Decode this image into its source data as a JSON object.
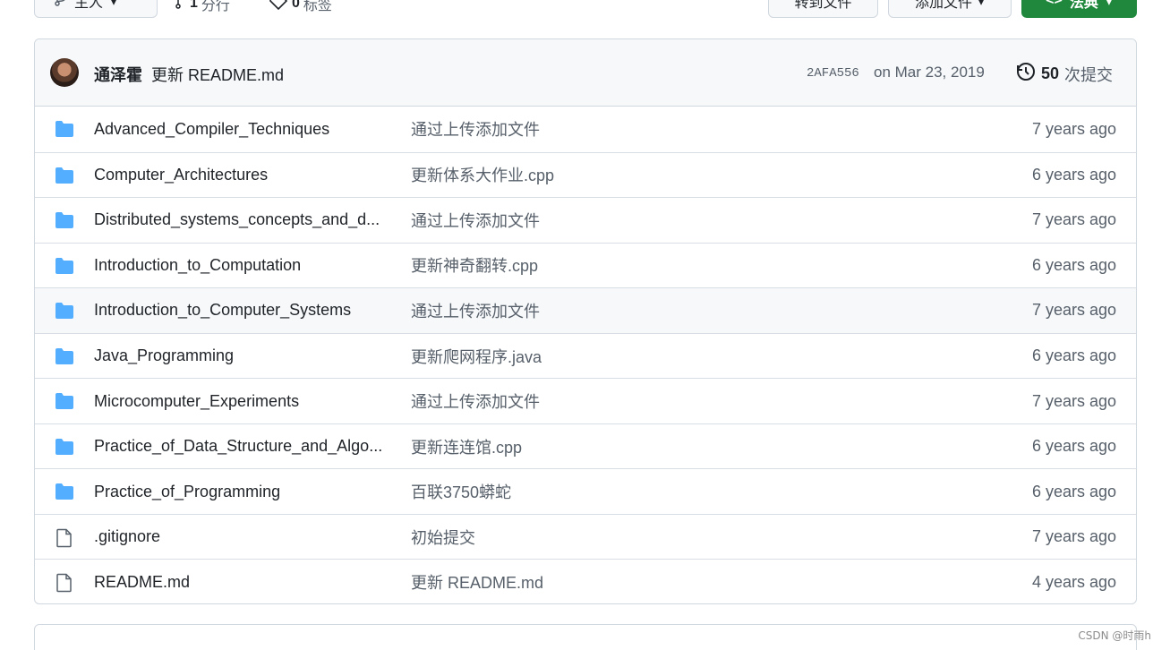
{
  "toolbar": {
    "branch_label": "主人",
    "branches_count": "1",
    "branches_label": "分行",
    "tags_count": "0",
    "tags_label": "标签",
    "goto_file_label": "转到文件",
    "add_file_label": "添加文件",
    "code_label": "法典"
  },
  "commit": {
    "author": "通泽霍",
    "message": "更新 README.md",
    "sha": "2AFA556",
    "date": "on Mar 23, 2019",
    "count": "50",
    "count_label": "次提交"
  },
  "files": [
    {
      "name": "Advanced_Compiler_Techniques",
      "type": "folder",
      "message": "通过上传添加文件",
      "age": "7 years ago"
    },
    {
      "name": "Computer_Architectures",
      "type": "folder",
      "message": "更新体系大作业.cpp",
      "age": "6 years ago"
    },
    {
      "name": "Distributed_systems_concepts_and_d...",
      "type": "folder",
      "message": "通过上传添加文件",
      "age": "7 years ago"
    },
    {
      "name": "Introduction_to_Computation",
      "type": "folder",
      "message": "更新神奇翻转.cpp",
      "age": "6 years ago"
    },
    {
      "name": "Introduction_to_Computer_Systems",
      "type": "folder",
      "message": "通过上传添加文件",
      "age": "7 years ago"
    },
    {
      "name": "Java_Programming",
      "type": "folder",
      "message": "更新爬网程序.java",
      "age": "6 years ago"
    },
    {
      "name": "Microcomputer_Experiments",
      "type": "folder",
      "message": "通过上传添加文件",
      "age": "7 years ago"
    },
    {
      "name": "Practice_of_Data_Structure_and_Algo...",
      "type": "folder",
      "message": "更新连连馆.cpp",
      "age": "6 years ago"
    },
    {
      "name": "Practice_of_Programming",
      "type": "folder",
      "message": "百联3750蟒蛇",
      "age": "6 years ago"
    },
    {
      "name": ".gitignore",
      "type": "file",
      "message": "初始提交",
      "age": "7 years ago"
    },
    {
      "name": "README.md",
      "type": "file",
      "message": "更新 README.md",
      "age": "4 years ago"
    }
  ],
  "watermark": "CSDN @时雨h",
  "colors": {
    "folder": "#54aeff",
    "accent": "#1f883d"
  }
}
